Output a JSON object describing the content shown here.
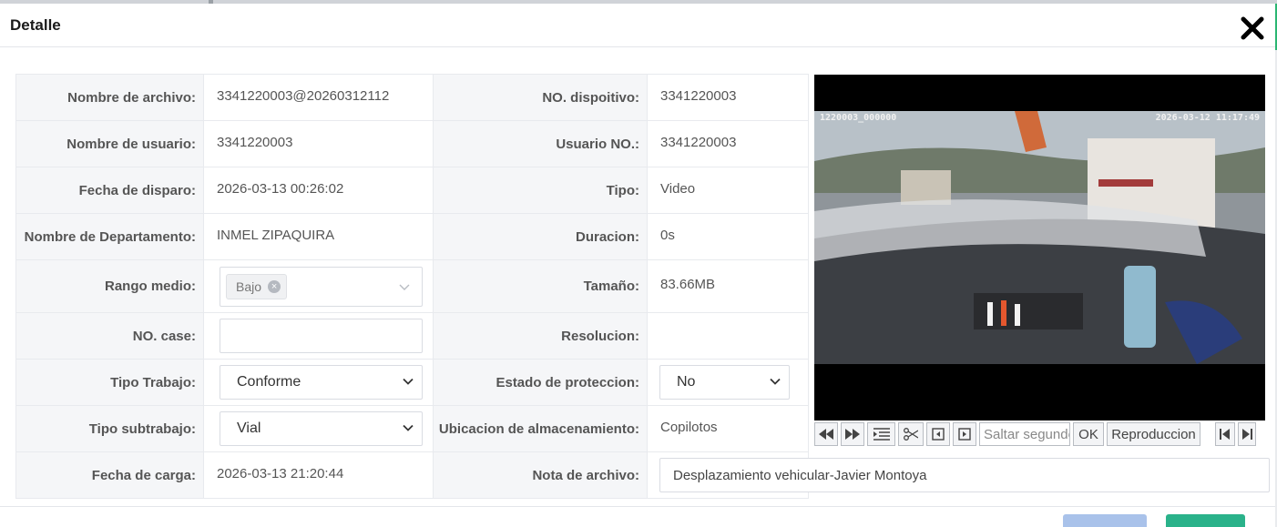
{
  "dialog": {
    "title": "Detalle"
  },
  "fields": {
    "nombre_archivo": {
      "label": "Nombre de archivo",
      "value": "3341220003@20260312112"
    },
    "no_dispositivo": {
      "label": "NO. dispoitivo",
      "value": "3341220003"
    },
    "nombre_usuario": {
      "label": "Nombre de usuario",
      "value": "3341220003"
    },
    "usuario_no": {
      "label": "Usuario NO.",
      "value": "3341220003"
    },
    "fecha_disparo": {
      "label": "Fecha de disparo",
      "value": "2026-03-13 00:26:02"
    },
    "tipo": {
      "label": "Tipo",
      "value": "Video"
    },
    "departamento": {
      "label": "Nombre de Departamento",
      "value": "INMEL ZIPAQUIRA"
    },
    "duracion": {
      "label": "Duracion",
      "value": "0s"
    },
    "rango_medio": {
      "label": "Rango medio",
      "tag": "Bajo"
    },
    "tamano": {
      "label": "Tamaño",
      "value": "83.66MB"
    },
    "no_case": {
      "label": "NO. case",
      "value": ""
    },
    "resolucion": {
      "label": "Resolucion",
      "value": ""
    },
    "tipo_trabajo": {
      "label": "Tipo Trabajo",
      "value": "Conforme"
    },
    "estado_proteccion": {
      "label": "Estado de proteccion",
      "value": "No"
    },
    "tipo_subtrabajo": {
      "label": "Tipo subtrabajo",
      "value": "Vial"
    },
    "ubicacion": {
      "label": "Ubicacion de almacenamiento",
      "value": "Copilotos"
    },
    "fecha_carga": {
      "label": "Fecha de carga",
      "value": "2026-03-13 21:20:44"
    },
    "nota_archivo": {
      "label": "Nota de archivo",
      "value": "Desplazamiento vehicular-Javier Montoya"
    }
  },
  "video": {
    "osd_left": "1220003_000000",
    "osd_right": "2026-03-12  11:17:49",
    "skip_placeholder": "Saltar segundos",
    "ok_label": "OK",
    "playback_label": "Reproduccion"
  },
  "colors": {
    "accent_green": "#2bb673",
    "primary_blue": "#a9c2ea"
  }
}
